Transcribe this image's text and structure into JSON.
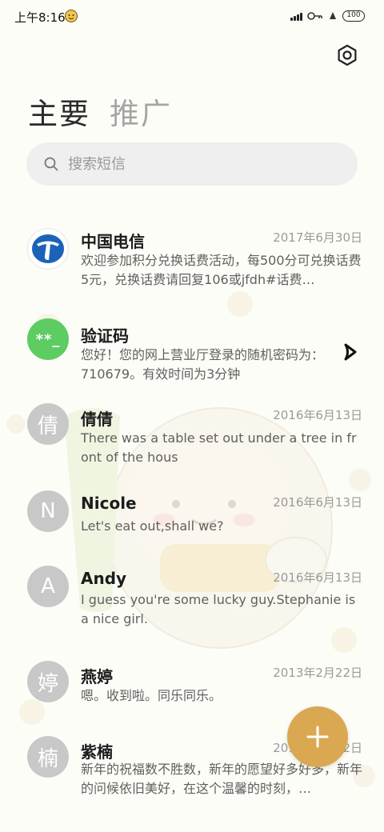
{
  "status_bar": {
    "time": "上午8:16",
    "battery": "100"
  },
  "tabs": [
    {
      "label": "主要",
      "active": true
    },
    {
      "label": "推广",
      "active": false
    }
  ],
  "search": {
    "placeholder": "搜索短信"
  },
  "conversations": [
    {
      "name": "中国电信",
      "date": "2017年6月30日",
      "preview": "欢迎参加积分兑换话费活动，每500分可兑换话费5元，兑换话费请回复106或jfdh#话费…",
      "avatar": "",
      "avatar_type": "logo"
    },
    {
      "name": "验证码",
      "date": "",
      "preview": "您好！您的网上营业厅登录的随机密码为：710679。有效时间为3分钟",
      "avatar": "**_",
      "avatar_type": "green"
    },
    {
      "name": "倩倩",
      "date": "2016年6月13日",
      "preview": "There was a table set out under a tree in front of the hous",
      "avatar": "倩",
      "avatar_type": "gray"
    },
    {
      "name": "Nicole",
      "date": "2016年6月13日",
      "preview": "Let's eat out,shall we?",
      "avatar": "N",
      "avatar_type": "gray"
    },
    {
      "name": "Andy",
      "date": "2016年6月13日",
      "preview": "I guess you're some lucky guy.Stephanie is a nice girl.",
      "avatar": "A",
      "avatar_type": "gray"
    },
    {
      "name": "燕婷",
      "date": "2013年2月22日",
      "preview": "嗯。收到啦。同乐同乐。",
      "avatar": "婷",
      "avatar_type": "gray"
    },
    {
      "name": "紫楠",
      "date": "2013年2月22日",
      "preview": "新年的祝福数不胜数，新年的愿望好多好多，新年的问候依旧美好，在这个温馨的时刻，…",
      "avatar": "楠",
      "avatar_type": "gray"
    }
  ],
  "colors": {
    "fab": "#d9a851",
    "verify_avatar": "#5ccc63",
    "gray_avatar": "#c8c8c8"
  },
  "icons": {
    "settings": "hexagon-gear-icon",
    "search": "search-icon",
    "new_message": "plus-icon",
    "expand": "chevron-right-icon"
  }
}
